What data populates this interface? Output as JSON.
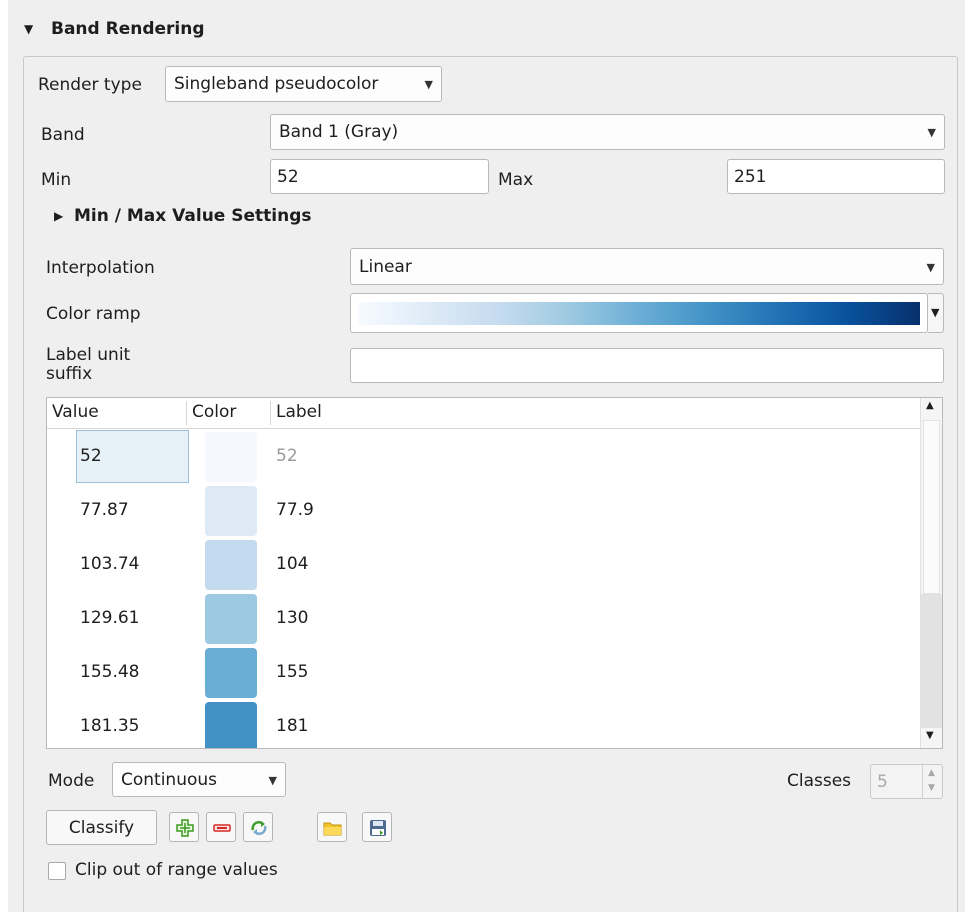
{
  "section": {
    "title": "Band Rendering"
  },
  "render_type": {
    "label": "Render type",
    "value": "Singleband pseudocolor"
  },
  "band": {
    "label": "Band",
    "value": "Band 1 (Gray)"
  },
  "min": {
    "label": "Min",
    "value": "52"
  },
  "max": {
    "label": "Max",
    "value": "251"
  },
  "minmax_settings": {
    "label": "Min / Max Value Settings"
  },
  "interpolation": {
    "label": "Interpolation",
    "value": "Linear"
  },
  "color_ramp": {
    "label": "Color ramp",
    "colors": [
      "#f7fbff",
      "#deebf7",
      "#c6dbef",
      "#9ecae1",
      "#6baed6",
      "#4292c6",
      "#2171b5",
      "#08519c",
      "#08306b"
    ]
  },
  "label_unit_suffix": {
    "label_line1": "Label unit",
    "label_line2": "suffix",
    "value": ""
  },
  "table": {
    "headers": {
      "value": "Value",
      "color": "Color",
      "label": "Label"
    },
    "rows": [
      {
        "value": "52",
        "color": "#f5f9fe",
        "label": "52"
      },
      {
        "value": "77.87",
        "color": "#dde9f5",
        "label": "77.9"
      },
      {
        "value": "103.74",
        "color": "#c4daee",
        "label": "104"
      },
      {
        "value": "129.61",
        "color": "#9dc9e1",
        "label": "130"
      },
      {
        "value": "155.48",
        "color": "#6aaed6",
        "label": "155"
      },
      {
        "value": "181.35",
        "color": "#4292c5",
        "label": "181"
      }
    ]
  },
  "mode": {
    "label": "Mode",
    "value": "Continuous"
  },
  "classes": {
    "label": "Classes",
    "value": "5"
  },
  "classify": {
    "label": "Classify"
  },
  "icons": [
    "add-values-icon",
    "remove-values-icon",
    "load-from-band-icon",
    "load-from-file-icon",
    "export-to-file-icon"
  ],
  "clip": {
    "label": "Clip out of range values",
    "checked": false
  }
}
